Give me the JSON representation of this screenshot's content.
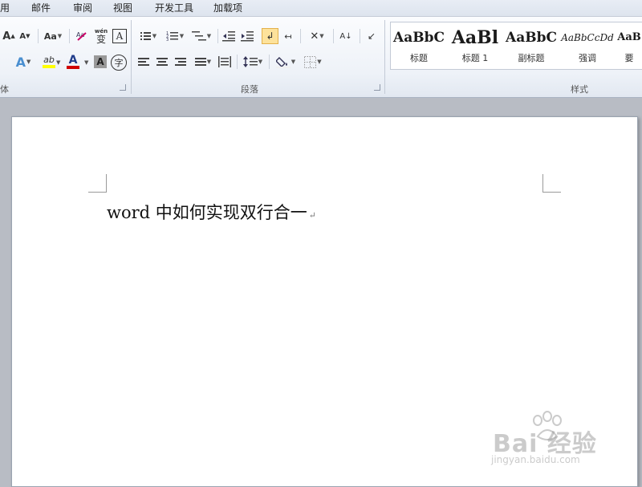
{
  "menu_tabs": [
    "用",
    "邮件",
    "审阅",
    "视图",
    "开发工具",
    "加载项"
  ],
  "ribbon": {
    "font_group_label": "体",
    "paragraph_group_label": "段落",
    "styles_group_label": "样式",
    "font_tools": {
      "grow_font": "A",
      "shrink_font": "A",
      "change_case": "Aa",
      "phonetic_guide": "wén",
      "character_border": "A",
      "text_effects": "A",
      "highlight_text": "ab",
      "font_color": "A",
      "character_shading": "A",
      "enclose_characters": "字"
    },
    "paragraph_tools": {
      "phonetic_marks": "拼",
      "show_marks": "↲",
      "sort": "A↓"
    },
    "styles": [
      {
        "sample": "AaBbC",
        "name": "标题"
      },
      {
        "sample": "AaBl",
        "name": "标题 1"
      },
      {
        "sample": "AaBbC",
        "name": "副标题"
      },
      {
        "sample": "AaBbCcDd",
        "name": "强调"
      },
      {
        "sample": "AaB",
        "name": "要"
      }
    ]
  },
  "document": {
    "line1": "word 中如何实现双行合一",
    "paragraph_mark": "↵"
  },
  "watermark": {
    "brand": "Bai  经验",
    "url": "jingyan.baidu.com"
  },
  "colors": {
    "highlight": "#ffff00",
    "font_color": "#d00000",
    "active_button": "#fde29b"
  }
}
